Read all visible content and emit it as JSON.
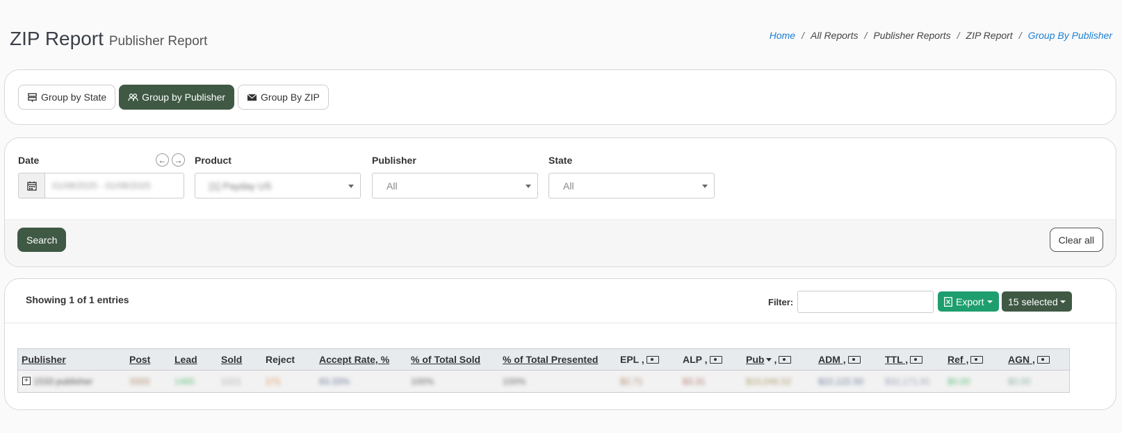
{
  "header": {
    "title": "ZIP Report",
    "subtitle": "Publisher Report"
  },
  "breadcrumb": [
    "Home",
    "All Reports",
    "Publisher Reports",
    "ZIP Report",
    "Group By Publisher"
  ],
  "groups": {
    "by_state": "Group by State",
    "by_publisher": "Group by Publisher",
    "by_zip": "Group By ZIP"
  },
  "filters": {
    "date_label": "Date",
    "date_value": "01/08/2025 - 01/08/2025",
    "product_label": "Product",
    "product_value": "[1] Payday US",
    "publisher_label": "Publisher",
    "publisher_value": "All",
    "state_label": "State",
    "state_value": "All",
    "search_label": "Search",
    "clear_label": "Clear all"
  },
  "table": {
    "showing": "Showing 1 of 1 entries",
    "filter_label": "Filter:",
    "export_label": "Export",
    "selected_label": "15 selected",
    "columns": [
      "Publisher",
      "Post",
      "Lead",
      "Sold",
      "Reject",
      "Accept Rate, %",
      "% of Total Sold",
      "% of Total Presented",
      "EPL ,",
      "ALP ,",
      "Pub",
      "ADM ,",
      "TTL ,",
      "Ref ,",
      "AGN ,"
    ],
    "row": {
      "publisher": "1533 publisher",
      "post": "3333",
      "lead": "1465",
      "sold": "1221",
      "reject": "171",
      "accept_rate": "83.33%",
      "pct_sold": "100%",
      "pct_presented": "100%",
      "epl": "$2.71",
      "alp": "$3.31",
      "pub": "$10,046.52",
      "adm": "$22,122.50",
      "ttl": "$32,171.91",
      "ref": "$0.00",
      "agn": "$0.00"
    }
  },
  "colors": {
    "primary": "#3f5944",
    "export": "#1e9e6e",
    "link": "#1a7fd6"
  }
}
